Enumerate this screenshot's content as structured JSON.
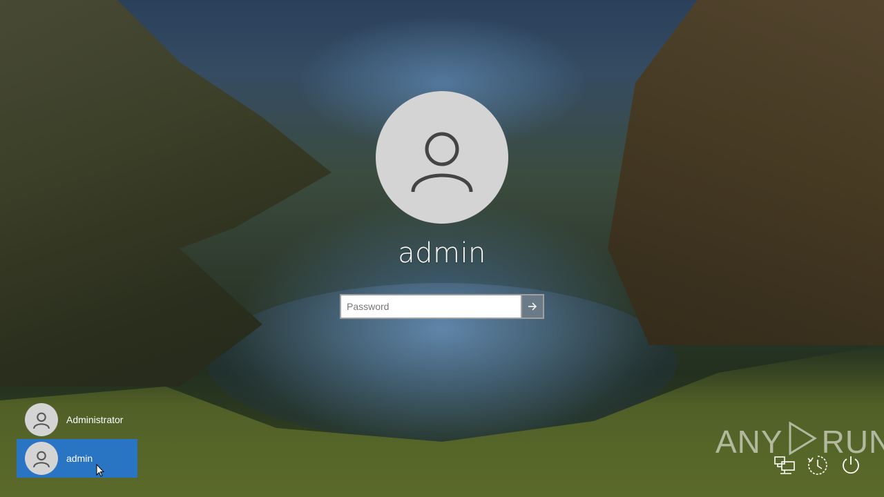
{
  "login": {
    "username": "admin",
    "password_placeholder": "Password"
  },
  "users": [
    {
      "name": "Administrator",
      "selected": false
    },
    {
      "name": "admin",
      "selected": true
    }
  ],
  "watermark": {
    "left": "ANY",
    "right": "RUN"
  },
  "system_icons": [
    "network-icon",
    "ease-of-access-icon",
    "power-icon"
  ],
  "colors": {
    "selected_user_bg": "#2a74c4",
    "avatar_bg": "#d4d4d4",
    "submit_bg": "#6b7a87"
  }
}
